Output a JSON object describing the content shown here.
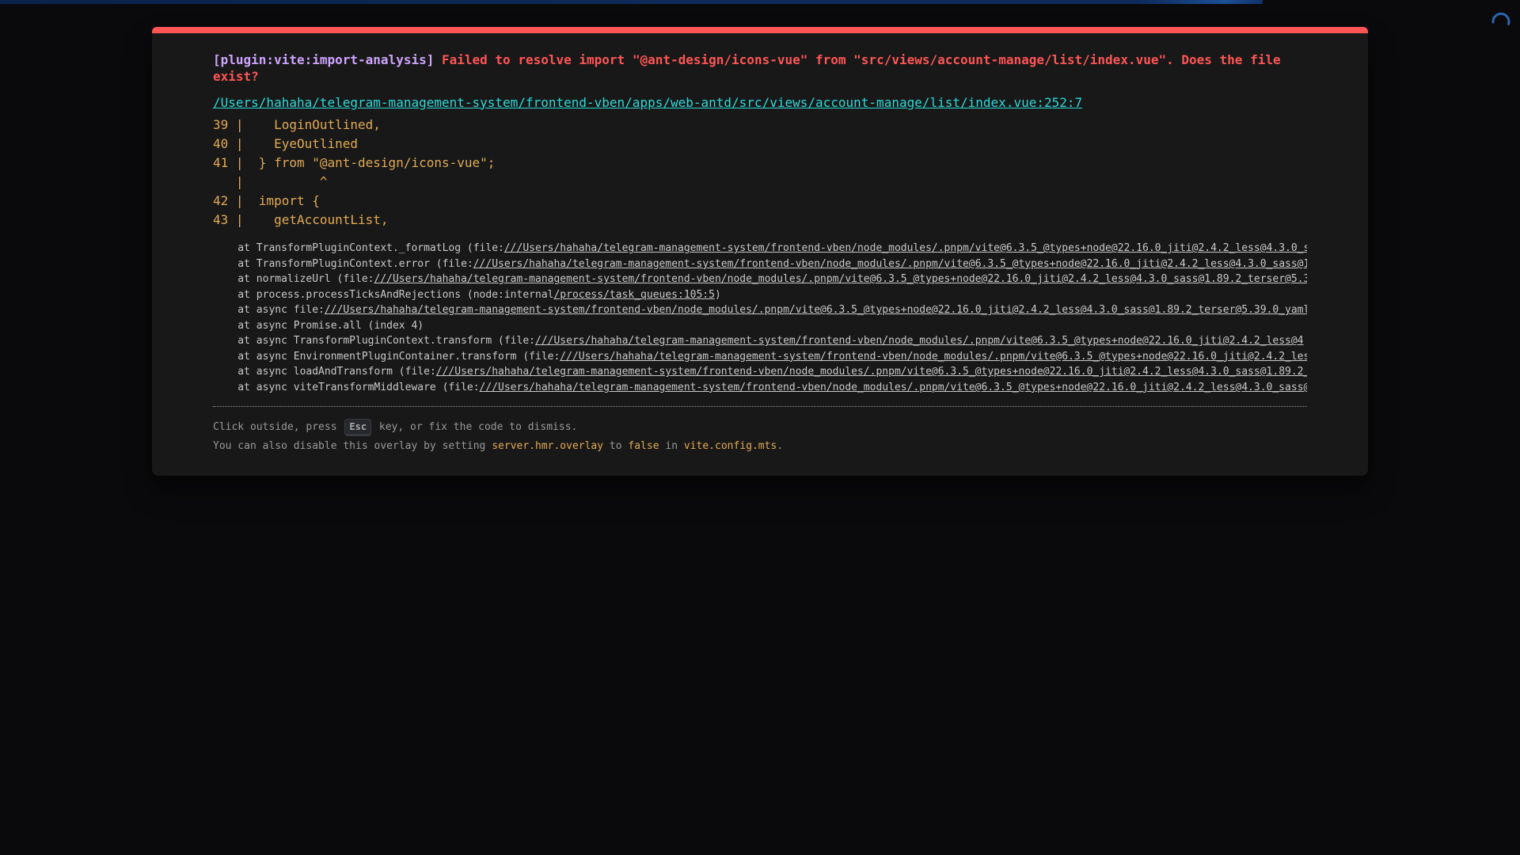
{
  "colors": {
    "page_bg": "#0a0a0c",
    "window_bg": "#181818",
    "window_text": "#d8d8d8",
    "accent_red": "#ff5555",
    "purple": "#cfa4ff",
    "cyan": "#2dd9da",
    "yellow": "#e2aa53",
    "dim": "#c9c9c9",
    "tip_gray": "#999999",
    "kbd_bg": "#26282c",
    "kbd_border": "#363940",
    "kbd_text": "#a6a7ab",
    "progress_blue": "#0d2a5a",
    "progress_blue_bright": "#1c4f96",
    "spinner_blue": "#2a66ad"
  },
  "page": {
    "progress_bar": "loading-progress",
    "spinner": "loading-spinner"
  },
  "overlay": {
    "message": {
      "plugin": "[plugin:vite:import-analysis]",
      "body": " Failed to resolve import \"@ant-design/icons-vue\" from \"src/views/account-manage/list/index.vue\". Does the file exist?"
    },
    "file_link": "/Users/hahaha/telegram-management-system/frontend-vben/apps/web-antd/src/views/account-manage/list/index.vue:252:7",
    "frame": "39 |    LoginOutlined,\n40 |    EyeOutlined\n41 |  } from \"@ant-design/icons-vue\";\n   |          ^\n42 |  import {\n43 |    getAccountList,",
    "stack": [
      {
        "pre": "    at TransformPluginContext._formatLog (file:",
        "link": "///Users/hahaha/telegram-management-system/frontend-vben/node_modules/.pnpm/vite@6.3.5_@types+node@22.16.0_jiti@2.4.2_less@4.3.0_s",
        "post": ""
      },
      {
        "pre": "    at TransformPluginContext.error (file:",
        "link": "///Users/hahaha/telegram-management-system/frontend-vben/node_modules/.pnpm/vite@6.3.5_@types+node@22.16.0_jiti@2.4.2_less@4.3.0_sass@1",
        "post": ""
      },
      {
        "pre": "    at normalizeUrl (file:",
        "link": "///Users/hahaha/telegram-management-system/frontend-vben/node_modules/.pnpm/vite@6.3.5_@types+node@22.16.0_jiti@2.4.2_less@4.3.0_sass@1.89.2_terser@5.3",
        "post": ""
      },
      {
        "pre": "    at process.processTicksAndRejections (node:internal",
        "link": "/process/task_queues:105:5",
        "post": ")"
      },
      {
        "pre": "    at async file:",
        "link": "///Users/hahaha/telegram-management-system/frontend-vben/node_modules/.pnpm/vite@6.3.5_@types+node@22.16.0_jiti@2.4.2_less@4.3.0_sass@1.89.2_terser@5.39.0_yaml",
        "post": ""
      },
      {
        "pre": "    at async Promise.all (index 4)",
        "link": "",
        "post": ""
      },
      {
        "pre": "    at async TransformPluginContext.transform (file:",
        "link": "///Users/hahaha/telegram-management-system/frontend-vben/node_modules/.pnpm/vite@6.3.5_@types+node@22.16.0_jiti@2.4.2_less@4",
        "post": ""
      },
      {
        "pre": "    at async EnvironmentPluginContainer.transform (file:",
        "link": "///Users/hahaha/telegram-management-system/frontend-vben/node_modules/.pnpm/vite@6.3.5_@types+node@22.16.0_jiti@2.4.2_les",
        "post": ""
      },
      {
        "pre": "    at async loadAndTransform (file:",
        "link": "///Users/hahaha/telegram-management-system/frontend-vben/node_modules/.pnpm/vite@6.3.5_@types+node@22.16.0_jiti@2.4.2_less@4.3.0_sass@1.89.2_",
        "post": ""
      },
      {
        "pre": "    at async viteTransformMiddleware (file:",
        "link": "///Users/hahaha/telegram-management-system/frontend-vben/node_modules/.pnpm/vite@6.3.5_@types+node@22.16.0_jiti@2.4.2_less@4.3.0_sass@",
        "post": ""
      }
    ],
    "tip": {
      "line1_pre": "Click outside, press ",
      "kbd": "Esc",
      "line1_post": " key, or fix the code to dismiss.",
      "line2_segments": [
        {
          "t": "You can also disable this overlay by setting ",
          "code": false
        },
        {
          "t": "server.hmr.overlay",
          "code": true
        },
        {
          "t": " to ",
          "code": false
        },
        {
          "t": "false",
          "code": true
        },
        {
          "t": " in ",
          "code": false
        },
        {
          "t": "vite.config.mts",
          "code": true
        },
        {
          "t": ".",
          "code": false
        }
      ]
    }
  }
}
